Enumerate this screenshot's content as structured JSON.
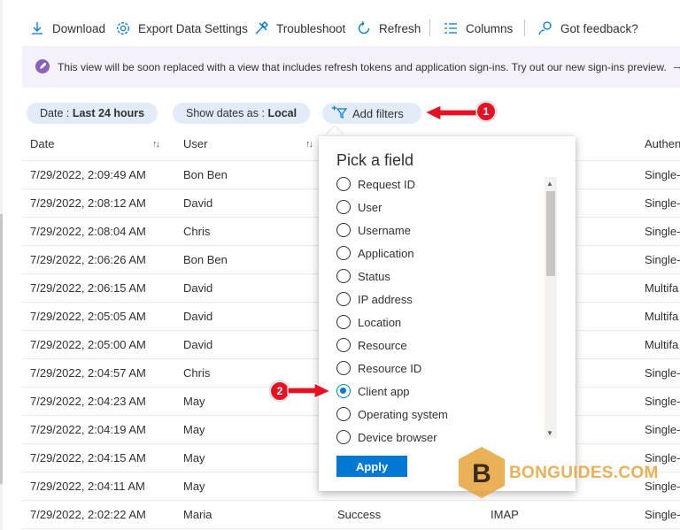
{
  "toolbar": {
    "download": "Download",
    "export": "Export Data Settings",
    "troubleshoot": "Troubleshoot",
    "refresh": "Refresh",
    "columns": "Columns",
    "feedback": "Got feedback?"
  },
  "banner": {
    "text": "This view will be soon replaced with a view that includes refresh tokens and application sign-ins. Try out our new sign-ins preview.",
    "arrow": "→"
  },
  "filters": {
    "date_label": "Date : ",
    "date_value": "Last 24 hours",
    "show_label": "Show dates as : ",
    "show_value": "Local",
    "add": "Add filters"
  },
  "table": {
    "headers": [
      "Date",
      "User",
      "Authen"
    ],
    "rows": [
      {
        "date": "7/29/2022, 2:09:49 AM",
        "user": "Bon Ben",
        "auth": "Single-"
      },
      {
        "date": "7/29/2022, 2:08:12 AM",
        "user": "David",
        "auth": "Single-"
      },
      {
        "date": "7/29/2022, 2:08:04 AM",
        "user": "Chris",
        "auth": "Single-"
      },
      {
        "date": "7/29/2022, 2:06:26 AM",
        "user": "Bon Ben",
        "auth": "Single-"
      },
      {
        "date": "7/29/2022, 2:06:15 AM",
        "user": "David",
        "auth": "Multifa"
      },
      {
        "date": "7/29/2022, 2:05:05 AM",
        "user": "David",
        "auth": "Multifa"
      },
      {
        "date": "7/29/2022, 2:05:00 AM",
        "user": "David",
        "auth": "Multifa"
      },
      {
        "date": "7/29/2022, 2:04:57 AM",
        "user": "Chris",
        "auth": "Single-"
      },
      {
        "date": "7/29/2022, 2:04:23 AM",
        "user": "May",
        "auth": "Single-"
      },
      {
        "date": "7/29/2022, 2:04:19 AM",
        "user": "May",
        "auth": "Single-"
      },
      {
        "date": "7/29/2022, 2:04:15 AM",
        "user": "May",
        "auth": "Single-"
      },
      {
        "date": "7/29/2022, 2:04:11 AM",
        "user": "May",
        "auth": "Single-"
      },
      {
        "date": "7/29/2022, 2:02:22 AM",
        "user": "Maria",
        "status": "Success",
        "app": "IMAP",
        "auth": "Single-"
      }
    ]
  },
  "picker": {
    "title": "Pick a field",
    "options": [
      "Request ID",
      "User",
      "Username",
      "Application",
      "Status",
      "IP address",
      "Location",
      "Resource",
      "Resource ID",
      "Client app",
      "Operating system",
      "Device browser"
    ],
    "selected": "Client app",
    "apply": "Apply"
  },
  "annotations": {
    "badge1": "1",
    "badge2": "2"
  },
  "watermark": {
    "letter": "B",
    "text": "BONGUIDES.COM"
  },
  "colors": {
    "accent": "#0078d4",
    "badge": "#e81123",
    "banner_bg": "#f5f1fa",
    "pill_bg": "#e1ecf8"
  }
}
